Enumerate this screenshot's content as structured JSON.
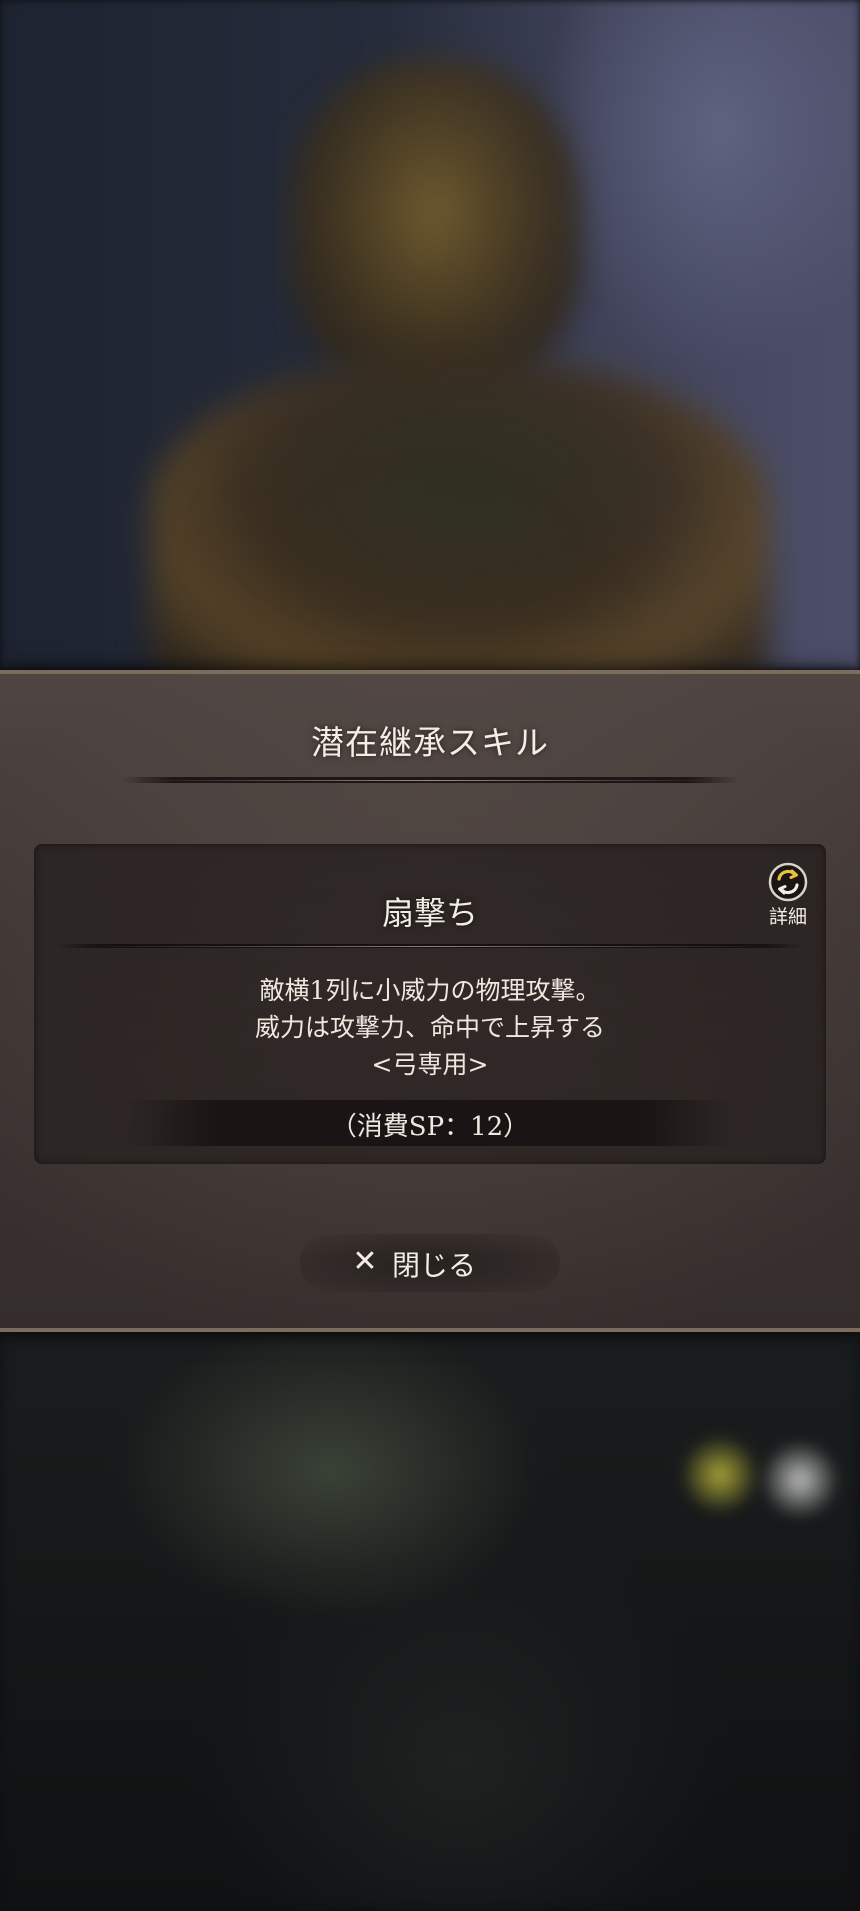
{
  "dialog": {
    "title": "潜在継承スキル",
    "close_label": "閉じる",
    "close_icon": "close-icon"
  },
  "skill": {
    "name": "扇撃ち",
    "detail_label": "詳細",
    "detail_icon": "swap-icon",
    "description_lines": [
      "敵横1列に小威力の物理攻撃。",
      "威力は攻撃力、命中で上昇する",
      "<弓専用>"
    ],
    "cost_text": "（消費SP：12）"
  },
  "colors": {
    "dialog_border": "#7c6c5e",
    "text": "#f3ede4",
    "icon_accent": "#e8c23a"
  }
}
